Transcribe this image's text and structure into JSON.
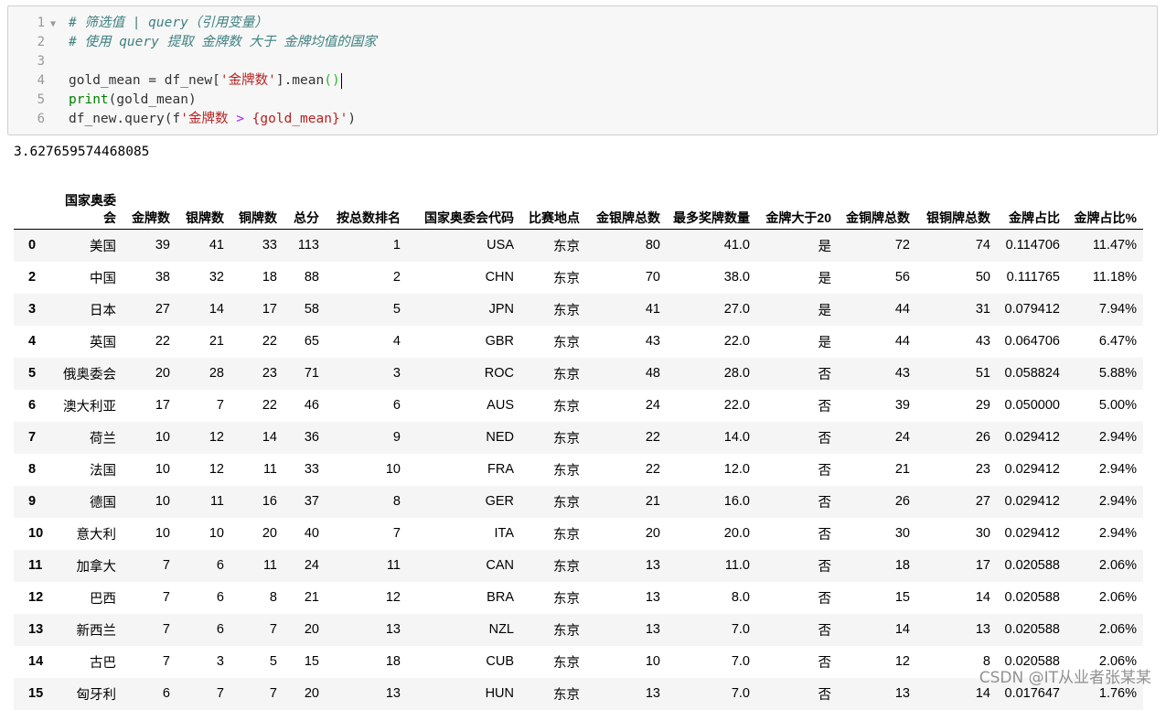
{
  "code": {
    "line_numbers": [
      "1",
      "2",
      "3",
      "4",
      "5",
      "6"
    ],
    "line1_comment": "# 筛选值 | query（引用变量）",
    "line2_comment": "# 使用 query 提取 金牌数 大于 金牌均值的国家",
    "line4_var": "gold_mean = df_new[",
    "line4_str": "'金牌数'",
    "line4_rest": "].mean",
    "line4_paren": "()",
    "line5_kw": "print",
    "line5_rest": "(gold_mean)",
    "line6_a": "df_new.query(f",
    "line6_str1": "'金牌数 ",
    "line6_op": ">",
    "line6_str2": " {gold_mean}'",
    "line6_b": ")"
  },
  "output": {
    "print_value": "3.627659574468085"
  },
  "table": {
    "columns": [
      "",
      "国家奥委会",
      "金牌数",
      "银牌数",
      "铜牌数",
      "总分",
      "按总数排名",
      "国家奥委会代码",
      "比赛地点",
      "金银牌总数",
      "最多奖牌数量",
      "金牌大于20",
      "金铜牌总数",
      "银铜牌总数",
      "金牌占比",
      "金牌占比%"
    ],
    "rows": [
      [
        "0",
        "美国",
        "39",
        "41",
        "33",
        "113",
        "1",
        "USA",
        "东京",
        "80",
        "41.0",
        "是",
        "72",
        "74",
        "0.114706",
        "11.47%"
      ],
      [
        "2",
        "中国",
        "38",
        "32",
        "18",
        "88",
        "2",
        "CHN",
        "东京",
        "70",
        "38.0",
        "是",
        "56",
        "50",
        "0.111765",
        "11.18%"
      ],
      [
        "3",
        "日本",
        "27",
        "14",
        "17",
        "58",
        "5",
        "JPN",
        "东京",
        "41",
        "27.0",
        "是",
        "44",
        "31",
        "0.079412",
        "7.94%"
      ],
      [
        "4",
        "英国",
        "22",
        "21",
        "22",
        "65",
        "4",
        "GBR",
        "东京",
        "43",
        "22.0",
        "是",
        "44",
        "43",
        "0.064706",
        "6.47%"
      ],
      [
        "5",
        "俄奥委会",
        "20",
        "28",
        "23",
        "71",
        "3",
        "ROC",
        "东京",
        "48",
        "28.0",
        "否",
        "43",
        "51",
        "0.058824",
        "5.88%"
      ],
      [
        "6",
        "澳大利亚",
        "17",
        "7",
        "22",
        "46",
        "6",
        "AUS",
        "东京",
        "24",
        "22.0",
        "否",
        "39",
        "29",
        "0.050000",
        "5.00%"
      ],
      [
        "7",
        "荷兰",
        "10",
        "12",
        "14",
        "36",
        "9",
        "NED",
        "东京",
        "22",
        "14.0",
        "否",
        "24",
        "26",
        "0.029412",
        "2.94%"
      ],
      [
        "8",
        "法国",
        "10",
        "12",
        "11",
        "33",
        "10",
        "FRA",
        "东京",
        "22",
        "12.0",
        "否",
        "21",
        "23",
        "0.029412",
        "2.94%"
      ],
      [
        "9",
        "德国",
        "10",
        "11",
        "16",
        "37",
        "8",
        "GER",
        "东京",
        "21",
        "16.0",
        "否",
        "26",
        "27",
        "0.029412",
        "2.94%"
      ],
      [
        "10",
        "意大利",
        "10",
        "10",
        "20",
        "40",
        "7",
        "ITA",
        "东京",
        "20",
        "20.0",
        "否",
        "30",
        "30",
        "0.029412",
        "2.94%"
      ],
      [
        "11",
        "加拿大",
        "7",
        "6",
        "11",
        "24",
        "11",
        "CAN",
        "东京",
        "13",
        "11.0",
        "否",
        "18",
        "17",
        "0.020588",
        "2.06%"
      ],
      [
        "12",
        "巴西",
        "7",
        "6",
        "8",
        "21",
        "12",
        "BRA",
        "东京",
        "13",
        "8.0",
        "否",
        "15",
        "14",
        "0.020588",
        "2.06%"
      ],
      [
        "13",
        "新西兰",
        "7",
        "6",
        "7",
        "20",
        "13",
        "NZL",
        "东京",
        "13",
        "7.0",
        "否",
        "14",
        "13",
        "0.020588",
        "2.06%"
      ],
      [
        "14",
        "古巴",
        "7",
        "3",
        "5",
        "15",
        "18",
        "CUB",
        "东京",
        "10",
        "7.0",
        "否",
        "12",
        "8",
        "0.020588",
        "2.06%"
      ],
      [
        "15",
        "匈牙利",
        "6",
        "7",
        "7",
        "20",
        "13",
        "HUN",
        "东京",
        "13",
        "7.0",
        "否",
        "13",
        "14",
        "0.017647",
        "1.76%"
      ]
    ]
  },
  "watermark": "CSDN @IT从业者张某某"
}
